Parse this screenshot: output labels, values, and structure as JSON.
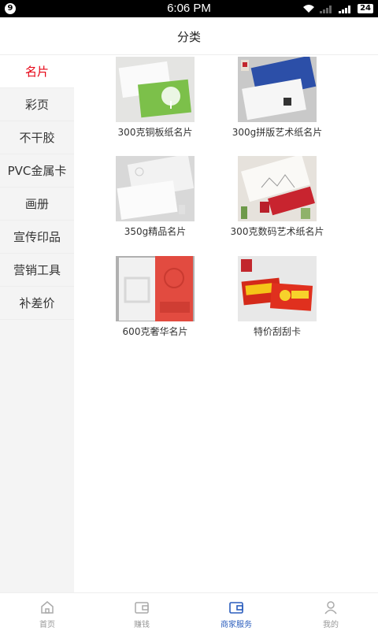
{
  "status_bar": {
    "notification_count": "9",
    "time": "6:06 PM",
    "battery": "24",
    "icons": [
      "wifi-icon",
      "signal-icon",
      "signal-icon",
      "battery-icon"
    ]
  },
  "header": {
    "title": "分类"
  },
  "sidebar": {
    "items": [
      {
        "label": "名片",
        "active": true
      },
      {
        "label": "彩页",
        "active": false
      },
      {
        "label": "不干胶",
        "active": false
      },
      {
        "label": "PVC金属卡",
        "active": false
      },
      {
        "label": "画册",
        "active": false
      },
      {
        "label": "宣传印品",
        "active": false
      },
      {
        "label": "营销工具",
        "active": false
      },
      {
        "label": "补差价",
        "active": false
      }
    ]
  },
  "products": [
    {
      "label": "300克铜板纸名片",
      "image": "green-tree-business-card"
    },
    {
      "label": "300g拼版艺术纸名片",
      "image": "blue-white-business-card"
    },
    {
      "label": "350g精品名片",
      "image": "white-embossed-card"
    },
    {
      "label": "300克数码艺术纸名片",
      "image": "red-white-art-card"
    },
    {
      "label": "600克奢华名片",
      "image": "red-luxury-card"
    },
    {
      "label": "特价刮刮卡",
      "image": "scratch-card"
    }
  ],
  "tabbar": {
    "items": [
      {
        "label": "首页",
        "icon": "home-icon",
        "active": false
      },
      {
        "label": "赚钱",
        "icon": "wallet-icon",
        "active": false
      },
      {
        "label": "商家服务",
        "icon": "merchant-wallet-icon",
        "active": true
      },
      {
        "label": "我的",
        "icon": "user-icon",
        "active": false
      }
    ],
    "accent": "#2a5dbd"
  },
  "colors": {
    "active_category": "#e60012",
    "sidebar_bg": "#f4f4f4"
  }
}
